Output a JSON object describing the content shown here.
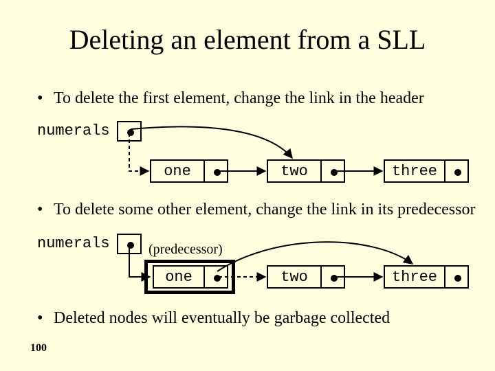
{
  "title": "Deleting an element from a SLL",
  "bullets": {
    "b1": "To delete the first element, change the link in the header",
    "b2": "To delete some other element, change the link in its predecessor",
    "b3": "Deleted nodes will eventually be garbage collected"
  },
  "labels": {
    "numerals": "numerals",
    "one": "one",
    "two": "two",
    "three": "three",
    "predecessor": "(predecessor)"
  },
  "page_number": "100"
}
